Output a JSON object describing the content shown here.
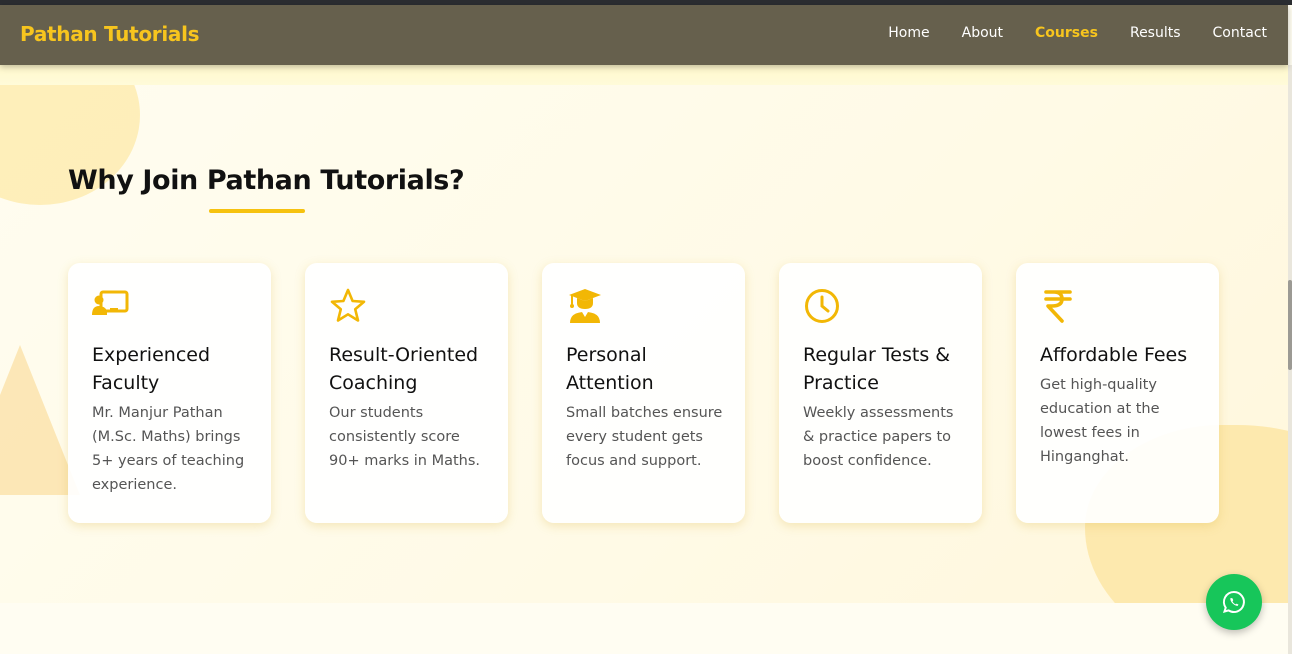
{
  "brand": "Pathan Tutorials",
  "nav": [
    {
      "label": "Home",
      "active": false
    },
    {
      "label": "About",
      "active": false
    },
    {
      "label": "Courses",
      "active": true
    },
    {
      "label": "Results",
      "active": false
    },
    {
      "label": "Contact",
      "active": false
    }
  ],
  "section": {
    "title": "Why Join Pathan Tutorials?"
  },
  "cards": [
    {
      "icon": "teacher-board-icon",
      "title": "Experienced Faculty",
      "text": "Mr. Manjur Pathan (M.Sc. Maths) brings 5+ years of teaching experience."
    },
    {
      "icon": "star-icon",
      "title": "Result-Oriented Coaching",
      "text": "Our students consistently score 90+ marks in Maths."
    },
    {
      "icon": "graduate-icon",
      "title": "Personal Attention",
      "text": "Small batches ensure every student gets focus and support."
    },
    {
      "icon": "clock-icon",
      "title": "Regular Tests & Practice",
      "text": "Weekly assessments & practice papers to boost confidence."
    },
    {
      "icon": "rupee-icon",
      "title": "Affordable Fees",
      "text": "Get high-quality education at the lowest fees in Hinganghat."
    }
  ],
  "colors": {
    "accent": "#f7c51e",
    "navbar": "#66604d",
    "whatsapp": "#17c65a"
  },
  "whatsapp_icon": "whatsapp-icon"
}
